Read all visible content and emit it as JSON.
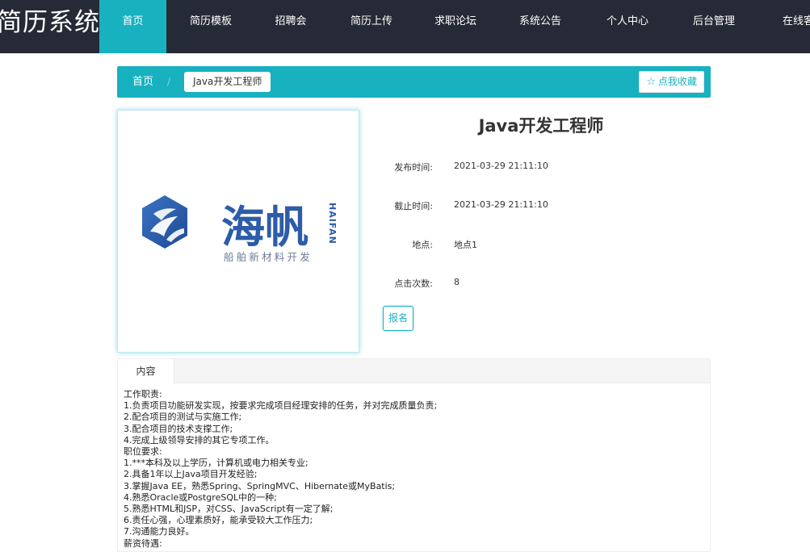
{
  "brand": "简历系统",
  "nav": {
    "items": [
      "首页",
      "简历模板",
      "招聘会",
      "简历上传",
      "求职论坛",
      "系统公告",
      "个人中心",
      "后台管理",
      "在线客服"
    ],
    "active_index": 0
  },
  "breadcrumb": {
    "home": "首页",
    "separator": "/",
    "current": "Java开发工程师",
    "favorite_button": "点我收藏"
  },
  "logo": {
    "name_cn": "海帆",
    "name_en": "HAIFAN",
    "slogan": "船舶新材料开发"
  },
  "job": {
    "title": "Java开发工程师",
    "fields": [
      {
        "label": "发布时间:",
        "value": "2021-03-29 21:11:10"
      },
      {
        "label": "截止时间:",
        "value": "2021-03-29 21:11:10"
      },
      {
        "label": "地点:",
        "value": "地点1"
      },
      {
        "label": "点击次数:",
        "value": "8"
      }
    ],
    "apply_button": "报名"
  },
  "content": {
    "tab": "内容",
    "lines": [
      "工作职责:",
      "1.负责项目功能研发实现，按要求完成项目经理安排的任务，并对完成质量负责;",
      "2.配合项目的测试与实施工作;",
      "3.配合项目的技术支撑工作;",
      "4.完成上级领导安排的其它专项工作。",
      "职位要求:",
      "1.***本科及以上学历，计算机或电力相关专业;",
      "2.具备1年以上Java项目开发经验;",
      "3.掌握Java EE，熟悉Spring、SpringMVC、Hibernate或MyBatis;",
      "4.熟悉Oracle或PostgreSQL中的一种;",
      "5.熟悉HTML和JSP，对CSS、JavaScript有一定了解;",
      "6.责任心强，心理素质好，能承受较大工作压力;",
      "7.沟通能力良好。",
      "薪资待遇:"
    ]
  },
  "colors": {
    "nav_bg": "#262a36",
    "accent": "#17b1c0",
    "logo_blue": "#2d5ca8"
  }
}
